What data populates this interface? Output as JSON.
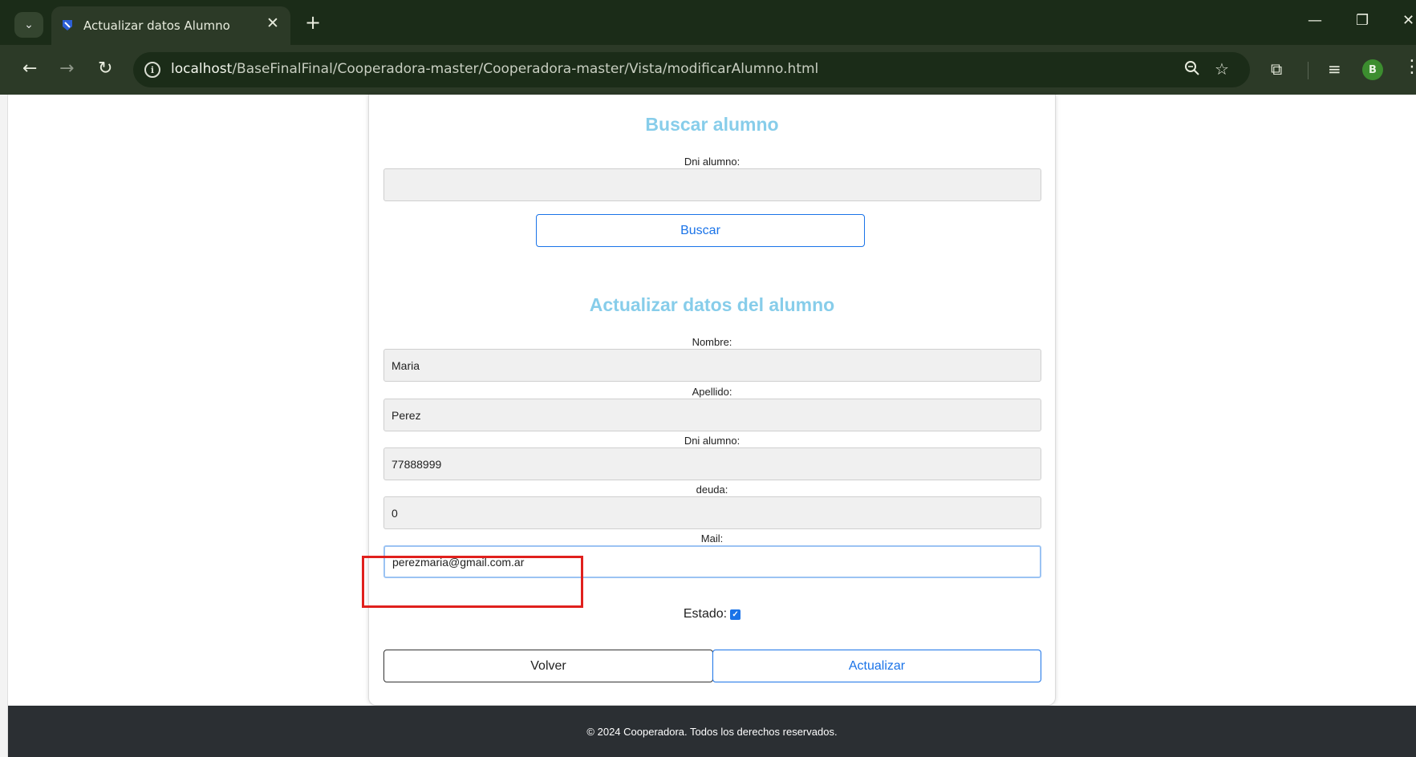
{
  "browser": {
    "tab_title": "Actualizar datos Alumno",
    "url_host": "localhost",
    "url_path": "/BaseFinalFinal/Cooperadora-master/Cooperadora-master/Vista/modificarAlumno.html",
    "avatar_initial": "B"
  },
  "search_section": {
    "title": "Buscar alumno",
    "dni_label": "Dni alumno:",
    "dni_value": "",
    "search_button": "Buscar"
  },
  "update_section": {
    "title": "Actualizar datos del alumno",
    "nombre_label": "Nombre:",
    "nombre_value": "Maria",
    "apellido_label": "Apellido:",
    "apellido_value": "Perez",
    "dni_label": "Dni alumno:",
    "dni_value": "77888999",
    "deuda_label": "deuda:",
    "deuda_value": "0",
    "mail_label": "Mail:",
    "mail_value": "perezmaria@gmail.com.ar",
    "estado_label": "Estado:",
    "estado_checked": true,
    "back_button": "Volver",
    "update_button": "Actualizar"
  },
  "footer": {
    "text": "© 2024 Cooperadora. Todos los derechos reservados."
  },
  "colors": {
    "title_color": "#87cdea",
    "primary_blue": "#1a73e8",
    "highlight_red": "#e0201d",
    "footer_bg": "#2b2f33"
  }
}
